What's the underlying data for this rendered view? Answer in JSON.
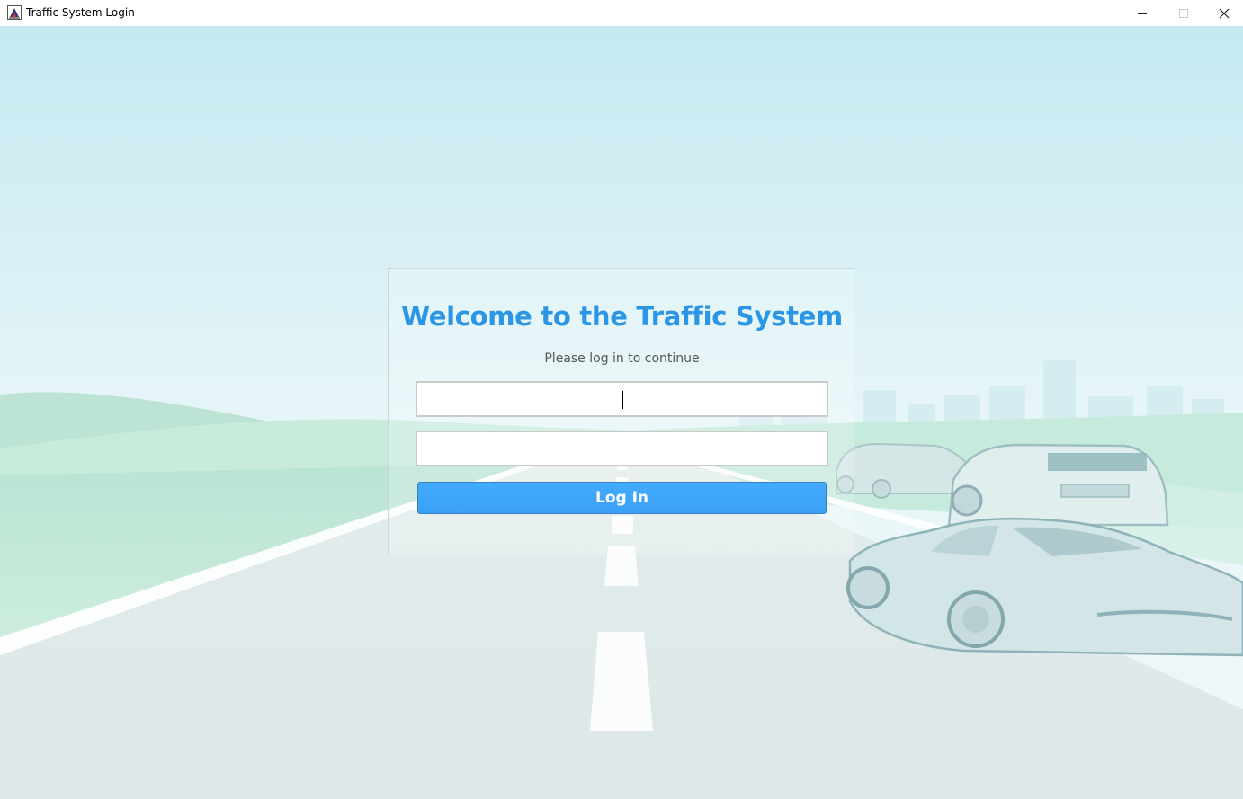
{
  "window": {
    "title": "Traffic System Login",
    "icon": "java-app-icon",
    "controls": {
      "minimize": "minimize-icon",
      "maximize": "maximize-icon",
      "close": "close-icon"
    }
  },
  "login": {
    "title": "Welcome to the Traffic System",
    "subtitle": "Please log in to continue",
    "username_value": "",
    "password_value": "",
    "button_label": "Log In"
  },
  "colors": {
    "title": "#2b95e6",
    "button": "#3ba3f8",
    "sky": "#c9eaf0",
    "grass": "#bfe6d4",
    "road": "#e2ebec"
  }
}
